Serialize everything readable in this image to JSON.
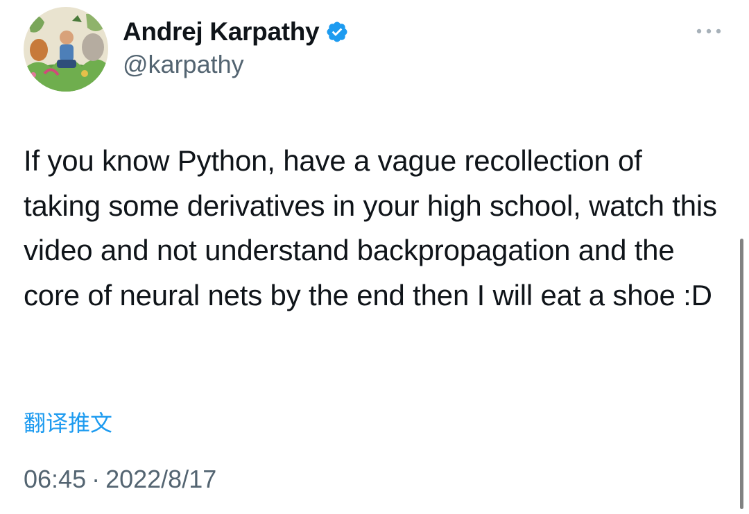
{
  "tweet": {
    "author": {
      "display_name": "Andrej Karpathy",
      "handle": "@karpathy",
      "verified": true,
      "verified_icon": "verified-badge-icon",
      "avatar_icon": "avatar-illustration"
    },
    "more_icon": "more-options-icon",
    "text": "If you know Python, have a vague recollection of taking some derivatives in your high school, watch this video and not understand backpropagation and the core of neural nets by the end then I will eat a shoe :D",
    "translate_label": "翻译推文",
    "time": "06:45",
    "separator": "·",
    "date": "2022/8/17"
  },
  "colors": {
    "accent": "#1d9bf0",
    "text_primary": "#0f1419",
    "text_secondary": "#536471"
  }
}
